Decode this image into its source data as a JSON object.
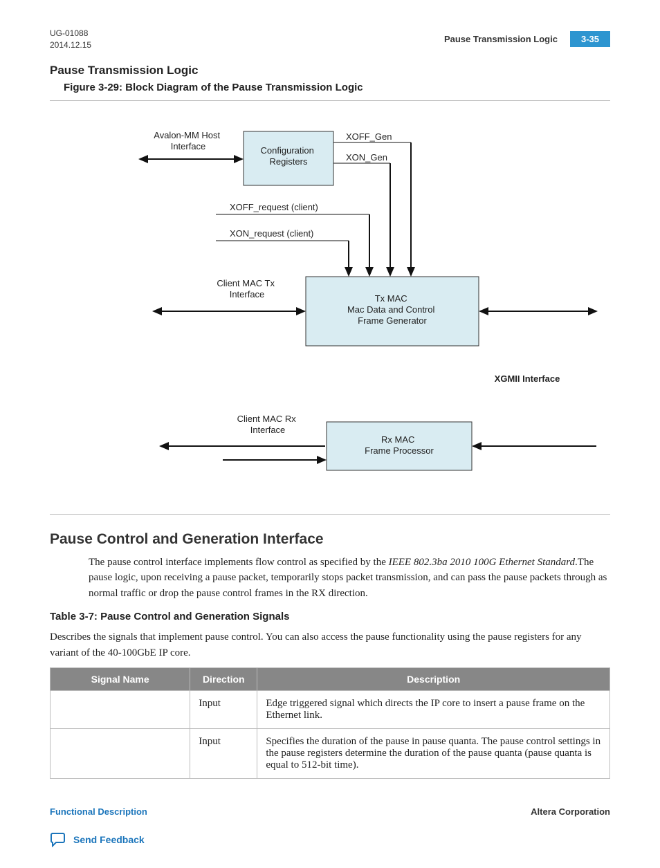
{
  "header": {
    "doc_id": "UG-01088",
    "date": "2014.12.15",
    "running_title": "Pause Transmission Logic",
    "page_number": "3-35"
  },
  "section1": {
    "heading": "Pause Transmission Logic",
    "figure_caption": "Figure 3-29: Block Diagram of the Pause Transmission Logic"
  },
  "diagram": {
    "config_block": "Configuration\nRegisters",
    "avalon_label": "Avalon-MM Host\nInterface",
    "xoff_gen": "XOFF_Gen",
    "xon_gen": "XON_Gen",
    "xoff_req": "XOFF_request (client)",
    "xon_req": "XON_request (client)",
    "client_tx": "Client MAC Tx\nInterface",
    "txmac": "Tx MAC\nMac Data and Control\nFrame Generator",
    "xgmii": "XGMII Interface",
    "client_rx": "Client MAC Rx\nInterface",
    "rxmac": "Rx MAC\nFrame Processor"
  },
  "section2": {
    "heading": "Pause Control and Generation Interface",
    "paragraph_pre": "The pause control interface implements flow control as specified by the ",
    "paragraph_ital": "IEEE 802.3ba 2010 100G Ethernet Standard",
    "paragraph_post": ".The pause logic, upon receiving a pause packet, temporarily stops packet transmission, and can pass the pause packets through as normal traffic or drop the pause control frames in the RX direction."
  },
  "table": {
    "title": "Table 3-7: Pause Control and Generation Signals",
    "description": "Describes the signals that implement pause control. You can also access the pause functionality using the pause registers for any variant of the 40-100GbE IP core.",
    "columns": {
      "c1": "Signal Name",
      "c2": "Direction",
      "c3": "Description"
    },
    "rows": [
      {
        "name": "",
        "dir": "Input",
        "desc": "Edge triggered signal which directs the IP core to insert a pause frame on the Ethernet link."
      },
      {
        "name": "",
        "dir": "Input",
        "desc": "Specifies the duration of the pause in pause quanta. The pause control settings in the pause registers determine the duration of the pause quanta (pause quanta is equal to 512-bit time)."
      }
    ]
  },
  "footer": {
    "left_link": "Functional Description",
    "right": "Altera Corporation",
    "feedback": "Send Feedback"
  },
  "chart_data": {
    "type": "diagram",
    "blocks": [
      {
        "id": "config",
        "label": "Configuration Registers"
      },
      {
        "id": "txmac",
        "label": "Tx MAC Mac Data and Control Frame Generator"
      },
      {
        "id": "rxmac",
        "label": "Rx MAC Frame Processor"
      }
    ],
    "external_interfaces": [
      "Avalon-MM Host Interface",
      "Client MAC Tx Interface",
      "Client MAC Rx Interface",
      "XGMII Interface"
    ],
    "signals": [
      {
        "name": "XOFF_Gen",
        "from": "config",
        "to": "txmac"
      },
      {
        "name": "XON_Gen",
        "from": "config",
        "to": "txmac"
      },
      {
        "name": "XOFF_request (client)",
        "from": "client",
        "to": "txmac"
      },
      {
        "name": "XON_request (client)",
        "from": "client",
        "to": "txmac"
      }
    ],
    "connections": [
      {
        "from": "Avalon-MM Host Interface",
        "to": "config",
        "bidir": true
      },
      {
        "from": "Client MAC Tx Interface",
        "to": "txmac",
        "bidir": true
      },
      {
        "from": "txmac",
        "to": "XGMII Interface",
        "bidir": true
      },
      {
        "from": "Client MAC Rx Interface",
        "to": "rxmac",
        "bidir": false,
        "reverse": true
      },
      {
        "from": "XGMII Interface",
        "to": "rxmac",
        "bidir": false
      }
    ]
  }
}
